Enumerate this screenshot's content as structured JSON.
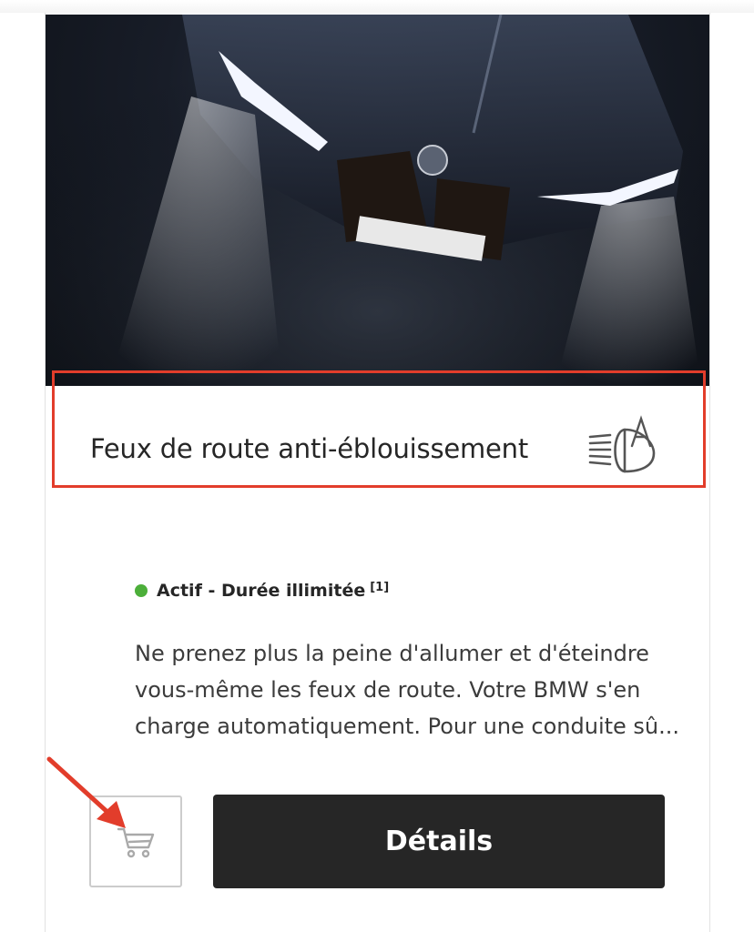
{
  "feature": {
    "title": "Feux de route anti-éblouissement",
    "icon": "high-beam-assistant-icon",
    "image": "bmw-front-headlights-photo"
  },
  "status": {
    "text": "Actif - Durée illimitée",
    "footnote": "[1]",
    "color": "#4caf3a"
  },
  "description": {
    "lines": [
      "Ne prenez plus la peine d'allumer et d'éteindre",
      "vous-même les feux de route. Votre BMW s'en",
      "charge automatiquement. Pour une conduite sû..."
    ]
  },
  "actions": {
    "cart_icon": "shopping-cart-icon",
    "details_label": "Détails"
  },
  "annotations": {
    "highlight_color": "#e23d2b"
  }
}
